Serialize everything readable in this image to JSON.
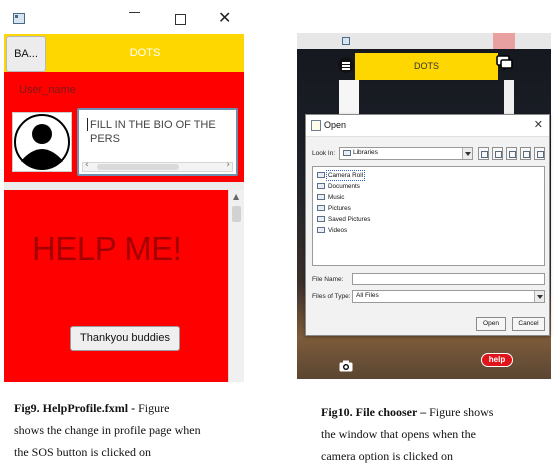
{
  "fig9": {
    "title_bar": {
      "minimize": "—",
      "maximize": "☐",
      "close": "✕"
    },
    "back_button": "BA...",
    "app_title": "DOTS",
    "user_name": "User_name",
    "bio_placeholder": "FILL IN THE BIO OF THE PERS\nHERE",
    "help_text": "HELP ME!",
    "thanks_button": "Thankyou buddies",
    "colors": {
      "red": "#ff0000",
      "yellow": "#ffd700",
      "dark_red_text": "#a40000"
    },
    "icons": [
      "app-window-icon",
      "avatar-icon",
      "scroll-arrow-icon"
    ]
  },
  "fig10": {
    "app_title": "DOTS",
    "help_chip": "help",
    "dialog": {
      "title": "Open",
      "close": "✕",
      "look_in_label": "Look In:",
      "look_in_value": "Libraries",
      "items": [
        "Camera Roll",
        "Documents",
        "Music",
        "Pictures",
        "Saved Pictures",
        "Videos"
      ],
      "file_name_label": "File Name:",
      "file_name_value": "",
      "files_of_type_label": "Files of Type:",
      "files_of_type_value": "All Files",
      "open_button": "Open",
      "cancel_button": "Cancel"
    },
    "icons": [
      "hamburger-menu-icon",
      "chat-bubble-icon",
      "camera-icon",
      "folder-icon"
    ]
  },
  "captions": {
    "fig9": {
      "label": "Fig9. HelpProfile.fxml -",
      "line1_rest": " Figure",
      "line2": "shows the change in profile page when",
      "line3": "the SOS button is clicked on"
    },
    "fig10": {
      "label": "Fig10. File chooser –",
      "line1_rest": " Figure shows",
      "line2": "the window that opens when the",
      "line3": "camera option is clicked on"
    }
  }
}
